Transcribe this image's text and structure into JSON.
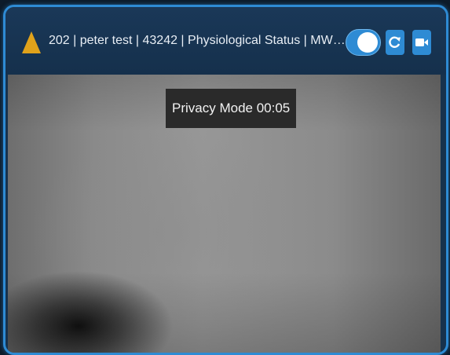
{
  "header": {
    "title": "202 | peter test | 43242 | Physiological Status | MWH T...",
    "warning_icon": "warning-triangle-icon",
    "warning_color": "#e0a21b",
    "toggle_on": true,
    "refresh_icon": "refresh-icon",
    "camera_icon": "video-camera-icon",
    "accent_color": "#2e8bd4"
  },
  "video": {
    "privacy_label": "Privacy Mode 00:05"
  }
}
